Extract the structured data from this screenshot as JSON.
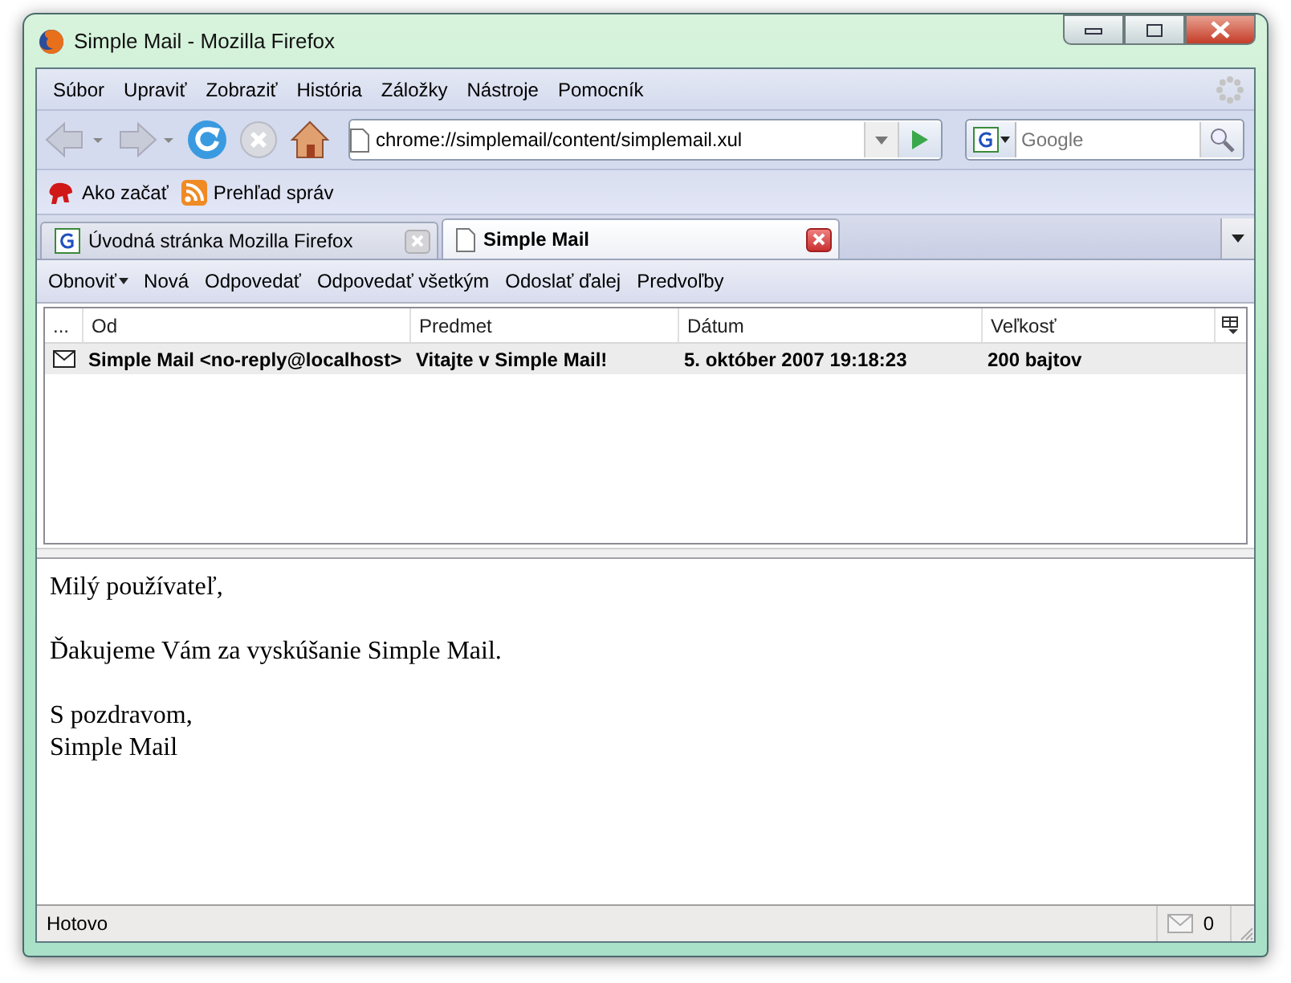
{
  "window": {
    "title": "Simple Mail - Mozilla Firefox"
  },
  "menu": [
    "Súbor",
    "Upraviť",
    "Zobraziť",
    "História",
    "Záložky",
    "Nástroje",
    "Pomocník"
  ],
  "navigation": {
    "url": "chrome://simplemail/content/simplemail.xul",
    "search": {
      "placeholder": "Google"
    }
  },
  "bookmarks": [
    {
      "label": "Ako začať",
      "kind": "dino"
    },
    {
      "label": "Prehľad správ",
      "kind": "rss"
    }
  ],
  "tabs": [
    {
      "label": "Úvodná stránka Mozilla Firefox",
      "kind": "google",
      "selected": false
    },
    {
      "label": "Simple Mail",
      "kind": "page",
      "selected": true
    }
  ],
  "mail_toolbar": [
    {
      "label": "Obnoviť",
      "kind": "menu"
    },
    {
      "label": "Nová",
      "kind": "plain"
    },
    {
      "label": "Odpovedať",
      "kind": "plain"
    },
    {
      "label": "Odpovedať všetkým",
      "kind": "plain"
    },
    {
      "label": "Odoslať ďalej",
      "kind": "plain"
    },
    {
      "label": "Predvoľby",
      "kind": "plain"
    }
  ],
  "message_list": {
    "columns": [
      "...",
      "Od",
      "Predmet",
      "Dátum",
      "Veľkosť"
    ],
    "rows": [
      {
        "from": "Simple Mail <no-reply@localhost>",
        "subject": "Vitajte v Simple Mail!",
        "date": "5. október 2007 19:18:23",
        "size": "200 bajtov",
        "unread": true
      }
    ]
  },
  "message_body": {
    "paragraphs": [
      [
        "Milý používateľ,"
      ],
      [
        "Ďakujeme Vám za vyskúšanie Simple Mail."
      ],
      [
        "S pozdravom,",
        "Simple Mail"
      ]
    ]
  },
  "status_bar": {
    "text": "Hotovo",
    "mail_count": "0"
  }
}
